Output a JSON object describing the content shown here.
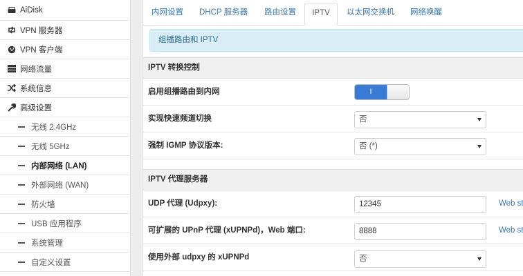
{
  "sidebar": {
    "items": [
      {
        "label": "AiDisk",
        "icon": "hdd-icon"
      },
      {
        "label": "VPN 服务器",
        "icon": "retweet-icon"
      },
      {
        "label": "VPN 客户端",
        "icon": "globe-icon"
      },
      {
        "label": "网络流量",
        "icon": "tasks-icon"
      },
      {
        "label": "系统信息",
        "icon": "random-icon"
      },
      {
        "label": "高级设置",
        "icon": "wrench-icon"
      }
    ],
    "subitems": [
      {
        "label": "无线 2.4GHz"
      },
      {
        "label": "无线 5GHz"
      },
      {
        "label": "内部网络 (LAN)",
        "active": true
      },
      {
        "label": "外部网络 (WAN)"
      },
      {
        "label": "防火墙"
      },
      {
        "label": "USB 应用程序"
      },
      {
        "label": "系统管理"
      },
      {
        "label": "自定义设置"
      }
    ]
  },
  "tabs": [
    {
      "label": "内网设置"
    },
    {
      "label": "DHCP 服务器"
    },
    {
      "label": "路由设置"
    },
    {
      "label": "IPTV",
      "active": true
    },
    {
      "label": "以太网交换机"
    },
    {
      "label": "网络唤醒"
    }
  ],
  "alert": {
    "text": "组播路由和 IPTV"
  },
  "sections": {
    "iptv_control": {
      "title": "IPTV 转换控制",
      "rows": {
        "multicast": {
          "label": "启用组播路由到内网",
          "toggle_text": "I",
          "enabled": true
        },
        "fast_leave": {
          "label": "实现快速频道切换",
          "value": "否"
        },
        "igmp": {
          "label": "强制 IGMP 协议版本:",
          "value": "否 (*)"
        }
      }
    },
    "proxy": {
      "title": "IPTV 代理服务器",
      "rows": {
        "udpxy": {
          "label": "UDP 代理 (Udpxy):",
          "value": "12345",
          "link": "Web st"
        },
        "xupnpd": {
          "label": "可扩展的 UPnP 代理 (xUPNPd)，Web 端口:",
          "value": "8888",
          "link": "Web st"
        },
        "external": {
          "label": "使用外部 udpxy 的 xUPNPd",
          "value": "否"
        }
      }
    }
  },
  "colors": {
    "accent": "#3a7bd5",
    "link": "#3a79b8",
    "alert_bg": "#d9edf7"
  }
}
